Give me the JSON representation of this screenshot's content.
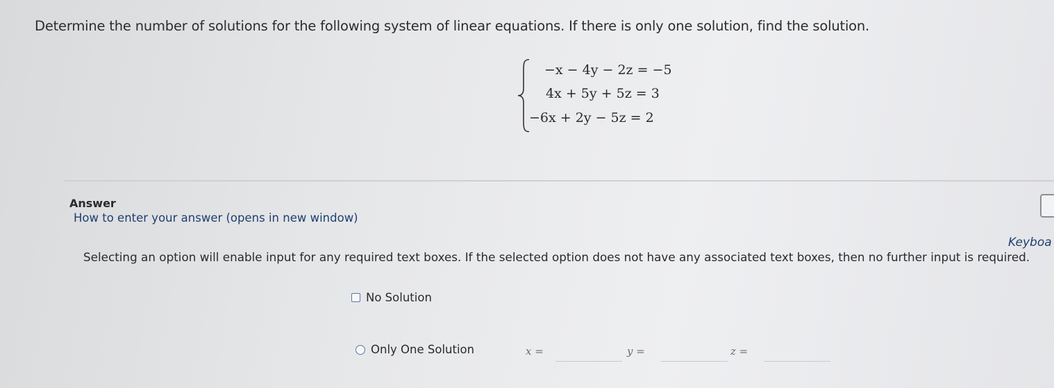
{
  "question": {
    "prompt": "Determine the number of solutions for the following system of linear equations. If there is only one solution, find the solution.",
    "equations": [
      "−x − 4y − 2z = −5",
      "4x + 5y + 5z = 3",
      "−6x + 2y − 5z = 2"
    ]
  },
  "answer": {
    "heading": "Answer",
    "help_link": "How to enter your answer (opens in new window)",
    "keyboard_label": "Keyboa",
    "instructions": "Selecting an option will enable input for any required text boxes. If the selected option does not have any associated text boxes, then no further input is required.",
    "options": [
      {
        "label": "No Solution"
      },
      {
        "label": "Only One Solution"
      }
    ],
    "fields": {
      "x_label": "x =",
      "y_label": "y =",
      "z_label": "z =",
      "x_value": "",
      "y_value": "",
      "z_value": ""
    }
  },
  "icons": {
    "keyboard": "keyboard-icon",
    "brace": "left-brace-icon"
  },
  "colors": {
    "link": "#1f3f6e",
    "control_border": "#5a78a8"
  }
}
